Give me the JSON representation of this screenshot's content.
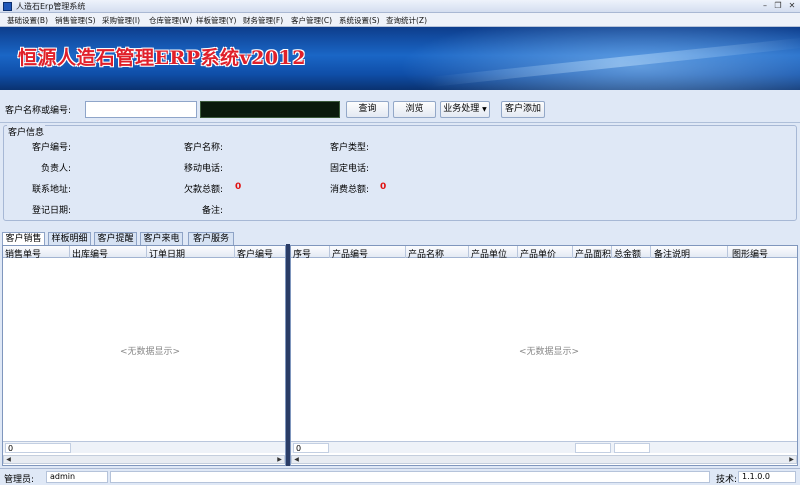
{
  "window": {
    "title": "人造石Erp管理系统",
    "min": "–",
    "restore": "❐",
    "close": "✕"
  },
  "menu": [
    "基础设置(B)",
    "销售管理(S)",
    "采购管理(I)",
    "仓库管理(W)",
    "样板管理(Y)",
    "财务管理(F)",
    "客户管理(C)",
    "系统设置(S)",
    "查询统计(Z)"
  ],
  "banner": {
    "title": "恒源人造石管理ERP系统v2012"
  },
  "search": {
    "label": "客户名称或编号:",
    "value": "",
    "query_btn": "查询",
    "browse_btn": "浏览",
    "business_btn": "业务处理",
    "add_btn": "客户添加"
  },
  "info": {
    "title": "客户信息",
    "customer_no": "客户编号:",
    "customer_name": "客户名称:",
    "customer_type": "客户类型:",
    "manager": "负责人:",
    "mobile": "移动电话:",
    "phone": "固定电话:",
    "address": "联系地址:",
    "arrears_label": "欠款总额:",
    "arrears_value": "0",
    "consume_label": "消费总额:",
    "consume_value": "0",
    "reg_date": "登记日期:",
    "remark": "备注:"
  },
  "tabs": [
    "客户销售",
    "样板明细",
    "客户提醒",
    "客户来电",
    "客户服务"
  ],
  "left_table": {
    "columns": [
      "销售单号",
      "出库编号",
      "订单日期",
      "客户编号"
    ],
    "empty": "<无数据显示>",
    "footer_count": "0"
  },
  "right_table": {
    "columns": [
      "序号",
      "产品编号",
      "产品名称",
      "产品单位",
      "产品单价",
      "产品面积",
      "总金额",
      "备注说明",
      "图形编号"
    ],
    "empty": "<无数据显示>",
    "footer_count": "0"
  },
  "status": {
    "admin_label": "管理员:",
    "admin_value": "admin",
    "tech_label": "技术:",
    "version": "1.1.0.0"
  },
  "colors": {
    "banner": "#1a66c6",
    "title_red": "#e0202a",
    "accent_red": "#e01010"
  }
}
